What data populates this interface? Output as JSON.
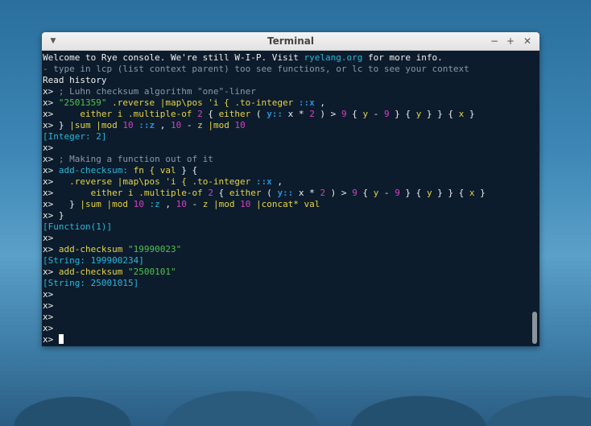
{
  "window": {
    "title": "Terminal",
    "menu_icon": "chevron-down-icon",
    "minimize_label": "−",
    "maximize_label": "+",
    "close_label": "✕"
  },
  "colors": {
    "background": "#0c1c2c",
    "string": "#4ec24e",
    "word": "#29b8db",
    "number": "#d441c4",
    "comment": "#8a98a6",
    "result": "#29b8db"
  },
  "terminal": {
    "lines": [
      [
        {
          "t": "Welcome to Rye console. We're still W-I-P. Visit ",
          "c": "white"
        },
        {
          "t": "ryelang.org",
          "c": "cyan"
        },
        {
          "t": " for more info.",
          "c": "white"
        }
      ],
      [
        {
          "t": "- type in lcp (list context parent) too see functions, or lc to see your context",
          "c": "grey"
        }
      ],
      [
        {
          "t": "Read history",
          "c": "white"
        }
      ],
      [
        {
          "t": "x> ",
          "c": "white"
        },
        {
          "t": "; Luhn checksum algorithm \"one\"-liner",
          "c": "grey"
        }
      ],
      [
        {
          "t": "x> ",
          "c": "white"
        },
        {
          "t": "\"2501359\"",
          "c": "green"
        },
        {
          "t": " .reverse |map\\pos 'i { .to-integer ",
          "c": "yellow"
        },
        {
          "t": "::x",
          "c": "blue",
          "b": true
        },
        {
          "t": " ,",
          "c": "white"
        }
      ],
      [
        {
          "t": "x>     ",
          "c": "white"
        },
        {
          "t": "either i .multiple-of ",
          "c": "yellow"
        },
        {
          "t": "2",
          "c": "magenta"
        },
        {
          "t": " { ",
          "c": "white"
        },
        {
          "t": "either",
          "c": "yellow"
        },
        {
          "t": " ( ",
          "c": "white"
        },
        {
          "t": "y::",
          "c": "blue",
          "b": true
        },
        {
          "t": " x * ",
          "c": "white"
        },
        {
          "t": "2",
          "c": "magenta"
        },
        {
          "t": " ) > ",
          "c": "white"
        },
        {
          "t": "9",
          "c": "magenta"
        },
        {
          "t": " { ",
          "c": "white"
        },
        {
          "t": "y",
          "c": "yellow"
        },
        {
          "t": " - ",
          "c": "white"
        },
        {
          "t": "9",
          "c": "magenta"
        },
        {
          "t": " } { ",
          "c": "white"
        },
        {
          "t": "y",
          "c": "yellow"
        },
        {
          "t": " } } { ",
          "c": "white"
        },
        {
          "t": "x",
          "c": "yellow"
        },
        {
          "t": " }",
          "c": "white"
        }
      ],
      [
        {
          "t": "x> } ",
          "c": "white"
        },
        {
          "t": "|sum |mod ",
          "c": "yellow"
        },
        {
          "t": "10",
          "c": "magenta"
        },
        {
          "t": " ::z",
          "c": "blue",
          "b": true
        },
        {
          "t": " , ",
          "c": "white"
        },
        {
          "t": "10",
          "c": "magenta"
        },
        {
          "t": " - ",
          "c": "white"
        },
        {
          "t": "z |mod ",
          "c": "yellow"
        },
        {
          "t": "10",
          "c": "magenta"
        }
      ],
      [
        {
          "t": "[Integer: 2]",
          "c": "cyan"
        }
      ],
      [
        {
          "t": "x>",
          "c": "white"
        }
      ],
      [
        {
          "t": "x> ",
          "c": "white"
        },
        {
          "t": "; Making a function out of it",
          "c": "grey"
        }
      ],
      [
        {
          "t": "x> ",
          "c": "white"
        },
        {
          "t": "add-checksum:",
          "c": "cyan"
        },
        {
          "t": " fn { ",
          "c": "yellow"
        },
        {
          "t": "val",
          "c": "yellow"
        },
        {
          "t": " } {",
          "c": "white"
        }
      ],
      [
        {
          "t": "x>   ",
          "c": "white"
        },
        {
          "t": ".reverse |map\\pos 'i { .to-integer ",
          "c": "yellow"
        },
        {
          "t": "::x",
          "c": "blue",
          "b": true
        },
        {
          "t": " ,",
          "c": "white"
        }
      ],
      [
        {
          "t": "x>       ",
          "c": "white"
        },
        {
          "t": "either i .multiple-of ",
          "c": "yellow"
        },
        {
          "t": "2",
          "c": "magenta"
        },
        {
          "t": " { ",
          "c": "white"
        },
        {
          "t": "either",
          "c": "yellow"
        },
        {
          "t": " ( ",
          "c": "white"
        },
        {
          "t": "y::",
          "c": "blue",
          "b": true
        },
        {
          "t": " x * ",
          "c": "white"
        },
        {
          "t": "2",
          "c": "magenta"
        },
        {
          "t": " ) > ",
          "c": "white"
        },
        {
          "t": "9",
          "c": "magenta"
        },
        {
          "t": " { ",
          "c": "white"
        },
        {
          "t": "y",
          "c": "yellow"
        },
        {
          "t": " - ",
          "c": "white"
        },
        {
          "t": "9",
          "c": "magenta"
        },
        {
          "t": " } { ",
          "c": "white"
        },
        {
          "t": "y",
          "c": "yellow"
        },
        {
          "t": " } } { ",
          "c": "white"
        },
        {
          "t": "x",
          "c": "yellow"
        },
        {
          "t": " }",
          "c": "white"
        }
      ],
      [
        {
          "t": "x>   } ",
          "c": "white"
        },
        {
          "t": "|sum |mod ",
          "c": "yellow"
        },
        {
          "t": "10",
          "c": "magenta"
        },
        {
          "t": " :z",
          "c": "cyan"
        },
        {
          "t": " , ",
          "c": "white"
        },
        {
          "t": "10",
          "c": "magenta"
        },
        {
          "t": " - ",
          "c": "white"
        },
        {
          "t": "z |mod ",
          "c": "yellow"
        },
        {
          "t": "10",
          "c": "magenta"
        },
        {
          "t": " |concat* val",
          "c": "yellow"
        }
      ],
      [
        {
          "t": "x> }",
          "c": "white"
        }
      ],
      [
        {
          "t": "[Function(1)]",
          "c": "cyan"
        }
      ],
      [
        {
          "t": "x>",
          "c": "white"
        }
      ],
      [
        {
          "t": "x> ",
          "c": "white"
        },
        {
          "t": "add-checksum ",
          "c": "yellow"
        },
        {
          "t": "\"19990023\"",
          "c": "green"
        }
      ],
      [
        {
          "t": "[String: 199900234]",
          "c": "cyan"
        }
      ],
      [
        {
          "t": "x> ",
          "c": "white"
        },
        {
          "t": "add-checksum ",
          "c": "yellow"
        },
        {
          "t": "\"2500101\"",
          "c": "green"
        }
      ],
      [
        {
          "t": "[String: 25001015]",
          "c": "cyan"
        }
      ],
      [
        {
          "t": "x>",
          "c": "white"
        }
      ],
      [
        {
          "t": "x>",
          "c": "white"
        }
      ],
      [
        {
          "t": "x>",
          "c": "white"
        }
      ],
      [
        {
          "t": "x>",
          "c": "white"
        }
      ],
      [
        {
          "t": "x> ",
          "c": "white"
        }
      ]
    ]
  }
}
